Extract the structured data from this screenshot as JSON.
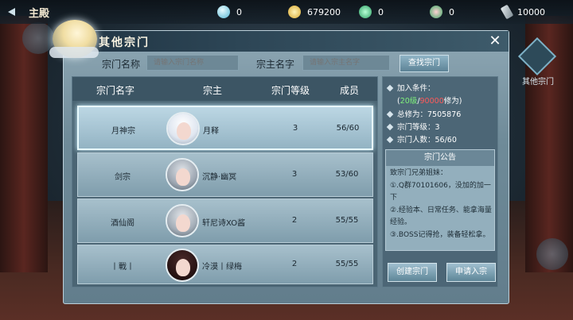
{
  "topbar": {
    "home_title": "主殿",
    "resources": [
      {
        "icon": "gem-icon",
        "value": "0",
        "color": "#7fd3e6"
      },
      {
        "icon": "coin-icon",
        "value": "679200",
        "color": "#e8c45a"
      },
      {
        "icon": "jade-icon",
        "value": "0",
        "color": "#48c07a"
      },
      {
        "icon": "lucky-icon",
        "value": "0",
        "color": "#5cc07a"
      },
      {
        "icon": "feather-icon",
        "value": "10000",
        "color": "#b7c1c8"
      }
    ]
  },
  "panel": {
    "title": "其他宗门",
    "close_label": "✕"
  },
  "search": {
    "sect_name_label": "宗门名称",
    "sect_name_placeholder": "请输入宗门名称",
    "leader_name_label": "宗主名字",
    "leader_name_placeholder": "请输入宗主名字",
    "button_label": "查找宗门"
  },
  "table": {
    "headers": [
      "宗门名字",
      "宗主",
      "宗门等级",
      "成员"
    ],
    "rows": [
      {
        "sect": "月神宗",
        "leader": "月释",
        "level": "3",
        "members": "56/60",
        "selected": true
      },
      {
        "sect": "剑宗",
        "leader": "沉静·幽冥",
        "level": "3",
        "members": "53/60",
        "selected": false
      },
      {
        "sect": "酒仙阁",
        "leader": "轩尼诗XO酱",
        "level": "2",
        "members": "55/55",
        "selected": false
      },
      {
        "sect": "丨戰丨",
        "leader": "冷漠丨绿梅",
        "level": "2",
        "members": "55/55",
        "selected": false
      }
    ]
  },
  "info": {
    "join_label": "加入条件：",
    "req_open": "(",
    "req_level": "20级",
    "req_slash": "/",
    "req_power": "90000",
    "req_close": "修为)",
    "total_power": "总修为：7505876",
    "sect_level": "宗门等级：3",
    "sect_members": "宗门人数：56/60",
    "notice_title": "宗门公告",
    "notice_text": "致宗门兄弟姐妹：\n①.Q群70101606，没加的加一下\n②.经验本、日常任务、能拿海量经验。\n③.BOSS记得抢，装备轻松拿。",
    "create_button": "创建宗门",
    "apply_button": "申请入宗"
  },
  "side": {
    "label": "其他宗门"
  }
}
